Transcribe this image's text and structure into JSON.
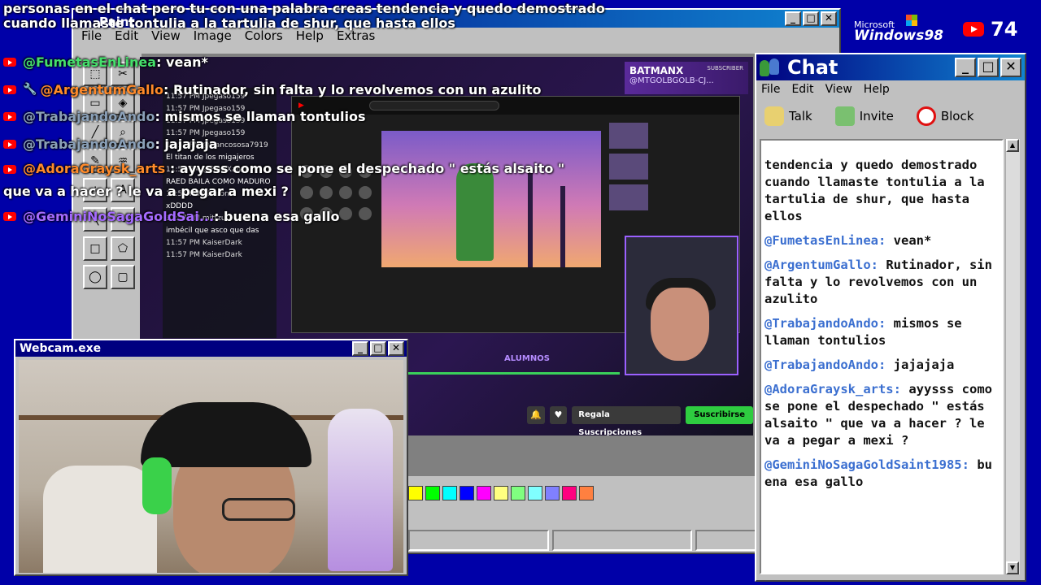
{
  "top_message": {
    "line1": "personas en el chat pero tu con una palabra creas tendencia y quedo demostrado",
    "line2": "cuando llamaste tontulia a la tartulia de shur, que hasta ellos"
  },
  "paint": {
    "title": "Paint",
    "menu": [
      "File",
      "Edit",
      "View",
      "Image",
      "Colors",
      "Help",
      "Extras"
    ],
    "palette": [
      "#ffff00",
      "#00ff00",
      "#00ffff",
      "#0000ff",
      "#ff00ff",
      "#ffff80",
      "#80ff80",
      "#80ffff",
      "#8080ff",
      "#ff0080",
      "#ff8040"
    ]
  },
  "overlay_chat": [
    {
      "user": "@FumetasEnLinea",
      "text": ": vean*",
      "color": "green",
      "icon": "youtube-icon"
    },
    {
      "user": "@ArgentumGallo",
      "text": ": Rutinador, sin falta y lo revolvemos con un azulito",
      "color": "orange",
      "icon": "youtube-icon",
      "mod": "wrench-icon"
    },
    {
      "user": "@TrabajandoAndo",
      "text": ": mismos se llaman tontulios",
      "color": "grey",
      "icon": "youtube-icon"
    },
    {
      "user": "@TrabajandoAndo",
      "text": ": jajajaja",
      "color": "grey",
      "icon": "youtube-icon"
    },
    {
      "user": "@AdoraGraysk_arts",
      "text": ": ayysss como se pone el despechado \" estás alsaito \" que va a hacer ? le va a pegar a mexi ?",
      "color": "orange",
      "icon": "youtube-icon"
    },
    {
      "user": "@GeminiNoSagaGoldSai...",
      "text": ": buena esa gallo",
      "color": "purple",
      "icon": "youtube-icon"
    }
  ],
  "windows_logo": {
    "brand": "Microsoft",
    "product": "Windows98"
  },
  "yt_viewers": "74",
  "stream": {
    "channel_name": "BATMANX",
    "channel_handle": "@MTGOLBGOLB-CJ...",
    "subscriber_label": "SUBSCRIBER",
    "overlay_logo": "ALUMNOS",
    "gift_button": "Regala Suscripciones",
    "subscribe_button": "Suscribirse",
    "left_chat": [
      "11:57 PM Jpegaso159",
      "11:57 PM Jpegaso159",
      "11:57 PM Jpegaso159",
      "11:57 PM Jpegaso159",
      "11:57 PM @francososa7919",
      "El titan de los migajeros",
      "11:57 PM @FrewXanzk",
      "RAED BAILA COMO MADURO",
      "11:57 PM Nhuron",
      "xDDDD",
      "11:57 PM mittzu",
      "imbécil que asco que das",
      "11:57 PM KaiserDark",
      "11:57 PM KaiserDark"
    ]
  },
  "webcam": {
    "title": "Webcam.exe"
  },
  "chat": {
    "title": "Chat",
    "menu": [
      "File",
      "Edit",
      "View",
      "Help"
    ],
    "tools": [
      {
        "label": "Talk",
        "icon": "talk-icon"
      },
      {
        "label": "Invite",
        "icon": "invite-icon"
      },
      {
        "label": "Block",
        "icon": "block-icon"
      }
    ],
    "intro": "tendencia y quedo demostrado cuando llamaste tontulia a la tartulia de shur, que hasta ellos",
    "messages": [
      {
        "user": "@FumetasEnLinea:",
        "text": "vean*"
      },
      {
        "user": "@ArgentumGallo:",
        "text": "Rutinador, sin falta y lo revolvemos con un azulito"
      },
      {
        "user": "@TrabajandoAndo:",
        "text": "mismos se llaman tontulios"
      },
      {
        "user": "@TrabajandoAndo:",
        "text": "jajajaja"
      },
      {
        "user": "@AdoraGraysk_arts:",
        "text": "ayysss como se pone el despechado \" estás alsaito \" que va a hacer ? le va a pegar a mexi ?"
      },
      {
        "user": "@GeminiNoSagaGoldSaint1985:",
        "text": "buena esa gallo"
      }
    ]
  }
}
